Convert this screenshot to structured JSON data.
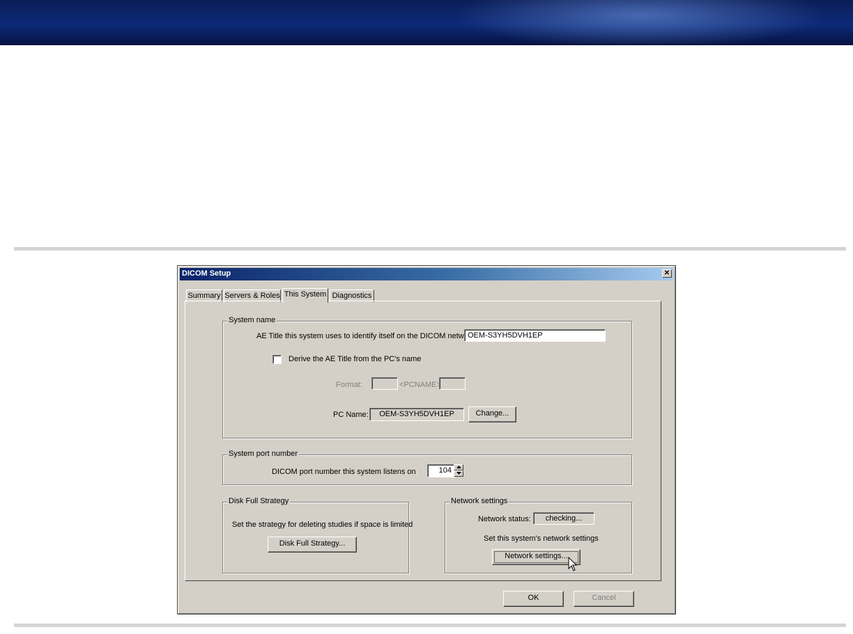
{
  "window": {
    "title": "DICOM Setup",
    "close_glyph": "✕"
  },
  "tabs": [
    {
      "label": "Summary",
      "active": false
    },
    {
      "label": "Servers & Roles",
      "active": false
    },
    {
      "label": "This System",
      "active": true
    },
    {
      "label": "Diagnostics",
      "active": false
    }
  ],
  "system_name": {
    "group_label": "System name",
    "ae_title_label": "AE Title this system uses to identify itself on the DICOM network:",
    "ae_title_value": "OEM-S3YH5DVH1EP",
    "derive_checkbox_label": "Derive the AE Title from the PC's name",
    "derive_checked": false,
    "format_label": "Format:",
    "format_prefix_value": "",
    "format_token": "<PCNAME>",
    "format_suffix_value": "",
    "pc_name_label": "PC Name:",
    "pc_name_value": "OEM-S3YH5DVH1EP",
    "change_button": "Change..."
  },
  "port": {
    "group_label": "System port number",
    "port_label": "DICOM port number this system listens on",
    "port_value": "104"
  },
  "disk_full": {
    "group_label": "Disk Full Strategy",
    "description": "Set the strategy for deleting studies if space is limited",
    "button": "Disk Full Strategy..."
  },
  "network": {
    "group_label": "Network settings",
    "status_label": "Network status:",
    "status_value": "checking...",
    "description": "Set this system's network settings",
    "button": "Network settings..."
  },
  "footer": {
    "ok_button": "OK",
    "cancel_button": "Cancel"
  },
  "colors": {
    "dialog_face": "#d4d0c8",
    "titlebar_start": "#0a246a",
    "titlebar_end": "#a6caf0",
    "banner": "#0d2a78"
  }
}
